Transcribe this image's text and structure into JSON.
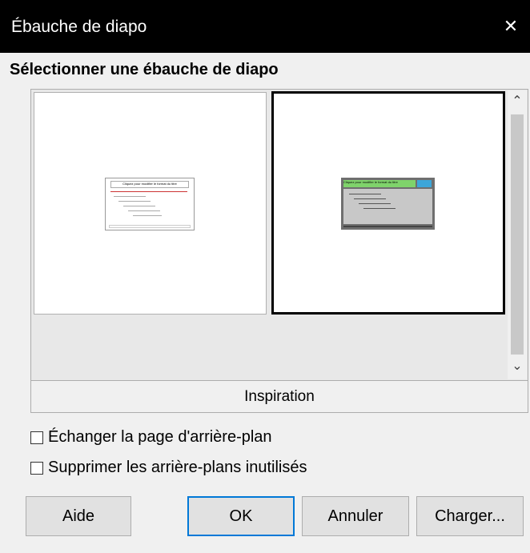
{
  "window": {
    "title": "Ébauche de diapo",
    "close_glyph": "✕"
  },
  "section": {
    "heading": "Sélectionner une ébauche de diapo"
  },
  "gallery": {
    "caption": "Inspiration",
    "items": [
      {
        "title_text": "Cliquez pour modifier le format du titre",
        "selected": false
      },
      {
        "title_text": "Cliquez pour modifier le format du titre",
        "selected": true
      }
    ],
    "scroll_up": "⌃",
    "scroll_down": "⌄"
  },
  "options": {
    "exchange_label": "Échanger la page d'arrière-plan",
    "delete_unused_label": "Supprimer les arrière-plans inutilisés",
    "exchange_checked": false,
    "delete_unused_checked": false
  },
  "buttons": {
    "help": "Aide",
    "ok": "OK",
    "cancel": "Annuler",
    "load": "Charger..."
  },
  "colors": {
    "accent": "#0078d7",
    "titlebar": "#000000",
    "green_bar": "#7fd36b"
  }
}
